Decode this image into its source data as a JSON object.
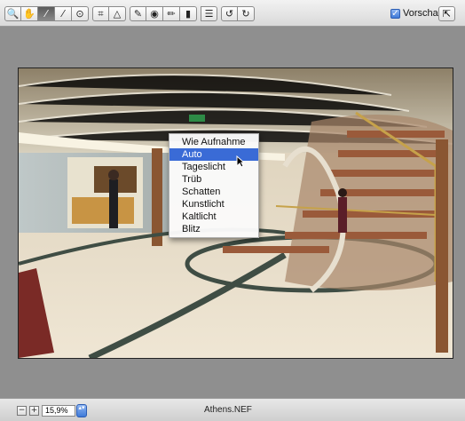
{
  "toolbar": {
    "tools": [
      {
        "name": "zoom-tool",
        "glyph": "🔍"
      },
      {
        "name": "hand-tool",
        "glyph": "✋"
      },
      {
        "name": "eyedropper-tool",
        "glyph": "⁄"
      },
      {
        "name": "color-sampler-tool",
        "glyph": "⁄"
      },
      {
        "name": "target-adjust-tool",
        "glyph": "⊙"
      },
      {
        "name": "crop-tool",
        "glyph": "⌗"
      },
      {
        "name": "straighten-tool",
        "glyph": "△"
      },
      {
        "name": "spot-removal-tool",
        "glyph": "✎"
      },
      {
        "name": "red-eye-tool",
        "glyph": "◉"
      },
      {
        "name": "brush-tool",
        "glyph": "✏"
      },
      {
        "name": "gradient-tool",
        "glyph": "▮"
      },
      {
        "name": "list-tool",
        "glyph": "☰"
      },
      {
        "name": "rotate-left-tool",
        "glyph": "↺"
      },
      {
        "name": "rotate-right-tool",
        "glyph": "↻"
      }
    ],
    "preview_checked": "✓",
    "preview_label": "Vorschau",
    "fullscreen_glyph": "⇱"
  },
  "menu": {
    "items": [
      "Wie Aufnahme",
      "Auto",
      "Tageslicht",
      "Trüb",
      "Schatten",
      "Kunstlicht",
      "Kaltlicht",
      "Blitz"
    ],
    "selected": "Auto"
  },
  "statusbar": {
    "zoom_out": "−",
    "zoom_in": "+",
    "zoom_value": "15,9%",
    "stepper_glyph": "▴▾",
    "filename": "Athens.NEF"
  }
}
